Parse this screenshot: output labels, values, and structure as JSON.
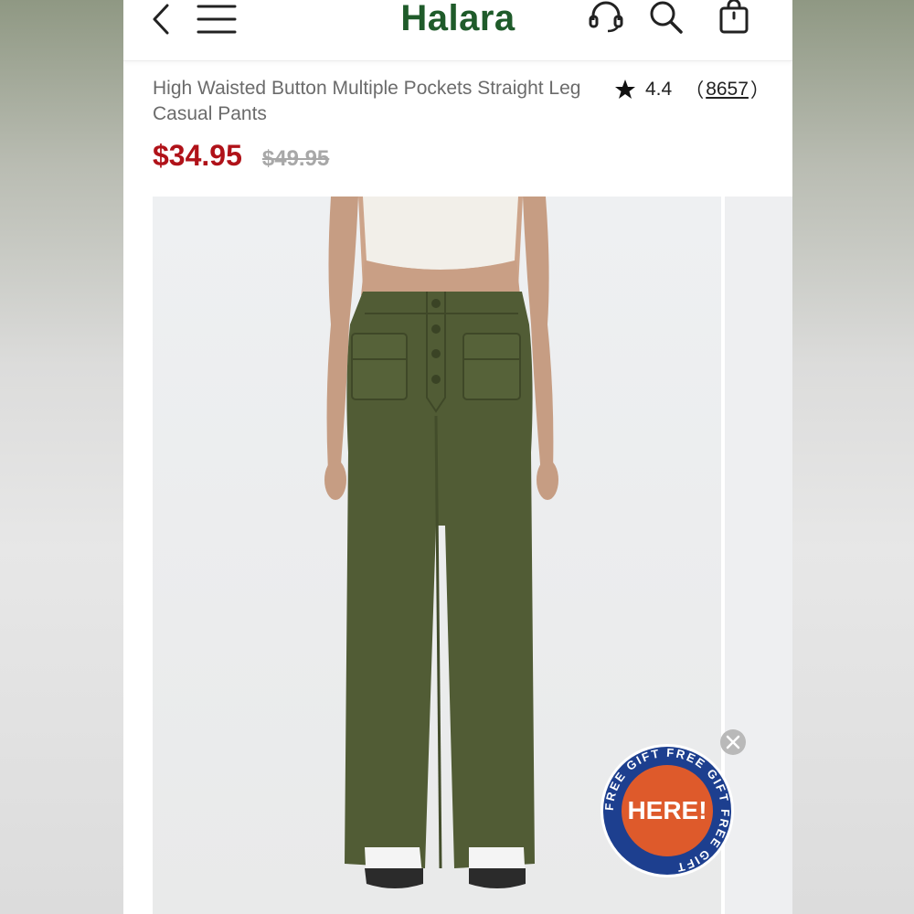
{
  "brand": {
    "name": "Halara",
    "color": "#1f5b2a"
  },
  "navbar": {
    "icons": [
      "back-icon",
      "menu-icon",
      "support-headset-icon",
      "search-icon",
      "shopping-bag-icon"
    ]
  },
  "product": {
    "title": "High Waisted Button Multiple Pockets Straight Leg Casual Pants",
    "rating": "4.4",
    "review_count": "8657",
    "price_current": "$34.95",
    "price_original": "$49.95",
    "price_color": "#b01219"
  },
  "promo": {
    "badge_center": "HERE!",
    "ring_text": "FREE GIFT FREE GIFT FREE GIFT",
    "badge_colors": {
      "ring": "#1d3f8f",
      "center": "#de5a2b"
    }
  },
  "colors": {
    "pants": "#515c35",
    "top": "#f2efe9"
  }
}
